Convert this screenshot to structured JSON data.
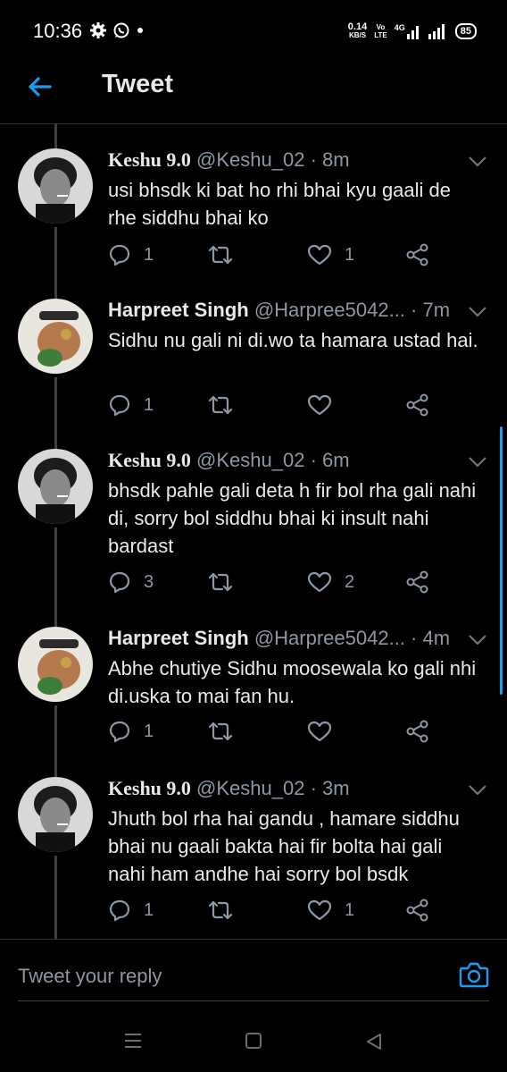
{
  "status_bar": {
    "time": "10:36",
    "net_speed_value": "0.14",
    "net_speed_unit": "KB/S",
    "volte_top": "Vo",
    "volte_bottom": "LTE",
    "network_type": "4G",
    "battery": "85",
    "icons": [
      "settings-gear-icon",
      "whatsapp-icon",
      "notification-dot-icon",
      "signal-icon",
      "signal-icon",
      "battery-icon"
    ]
  },
  "header": {
    "title": "Tweet",
    "back_icon": "arrow-left-icon"
  },
  "colors": {
    "accent": "#1d9bf0",
    "background": "#000000",
    "text_primary": "#e7e9ea",
    "text_secondary": "#8b98a5",
    "divider": "#2f3336"
  },
  "tweets": [
    {
      "name": "Keshu 9.0",
      "handle": "@Keshu_02",
      "time": "· 8m",
      "text": "usi bhsdk ki bat ho rhi bhai kyu gaali de rhe siddhu bhai ko",
      "replies": "1",
      "retweets": "",
      "likes": "1"
    },
    {
      "name": "Harpreet Singh",
      "handle": "@Harpree5042...",
      "time": "· 7m",
      "text": "Sidhu nu gali ni di.wo ta hamara ustad hai.",
      "replies": "1",
      "retweets": "",
      "likes": ""
    },
    {
      "name": "Keshu 9.0",
      "handle": "@Keshu_02",
      "time": "· 6m",
      "text": "bhsdk pahle gali deta h fir bol rha gali nahi di, sorry bol siddhu bhai ki insult nahi bardast",
      "replies": "3",
      "retweets": "",
      "likes": "2"
    },
    {
      "name": "Harpreet Singh",
      "handle": "@Harpree5042...",
      "time": "· 4m",
      "text": "Abhe chutiye Sidhu moosewala ko gali nhi di.uska to mai fan hu.",
      "replies": "1",
      "retweets": "",
      "likes": ""
    },
    {
      "name": "Keshu 9.0",
      "handle": "@Keshu_02",
      "time": "· 3m",
      "text": "Jhuth bol rha hai gandu , hamare siddhu bhai nu gaali bakta hai fir bolta hai gali nahi ham andhe hai sorry bol bsdk",
      "replies": "1",
      "retweets": "",
      "likes": "1"
    }
  ],
  "reply_bar": {
    "placeholder": "Tweet your reply",
    "camera_icon": "camera-icon"
  },
  "nav_bar": {
    "icons": [
      "recent-apps-icon",
      "home-icon",
      "back-icon"
    ]
  }
}
